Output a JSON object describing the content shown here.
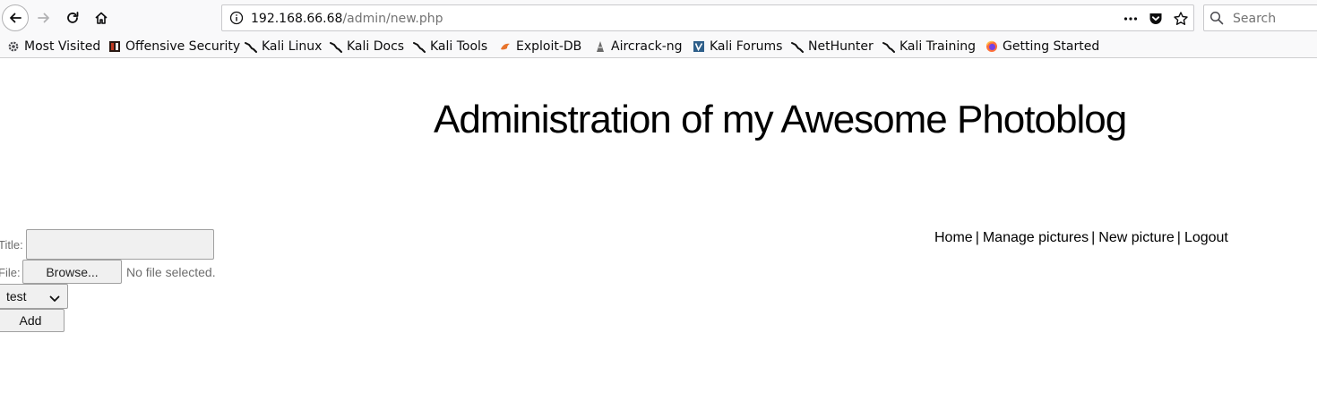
{
  "browser": {
    "url_host": "192.168.66.68",
    "url_path": "/admin/new.php",
    "search_placeholder": "Search",
    "bookmarks": [
      {
        "label": "Most Visited",
        "icon": "gear-icon"
      },
      {
        "label": "Offensive Security",
        "icon": "offsec-icon"
      },
      {
        "label": "Kali Linux",
        "icon": "kali-dragon-icon"
      },
      {
        "label": "Kali Docs",
        "icon": "kali-dragon-icon"
      },
      {
        "label": "Kali Tools",
        "icon": "kali-dragon-icon"
      },
      {
        "label": "Exploit-DB",
        "icon": "exploit-db-icon"
      },
      {
        "label": "Aircrack-ng",
        "icon": "aircrack-icon"
      },
      {
        "label": "Kali Forums",
        "icon": "kali-forums-icon"
      },
      {
        "label": "NetHunter",
        "icon": "kali-dragon-icon"
      },
      {
        "label": "Kali Training",
        "icon": "kali-dragon-icon"
      },
      {
        "label": "Getting Started",
        "icon": "firefox-icon"
      }
    ]
  },
  "page": {
    "title": "Administration of my Awesome Photoblog",
    "menu": {
      "home": "Home",
      "manage": "Manage pictures",
      "new": "New picture",
      "logout": "Logout",
      "separator": "|"
    },
    "form": {
      "title_label": "Title:",
      "title_value": "",
      "file_label": "File:",
      "browse_label": "Browse...",
      "no_file_text": "No file selected.",
      "category_selected": "test",
      "add_label": "Add"
    }
  },
  "colors": {
    "chrome_bg": "#f9f9fa",
    "text": "#0c0c0d",
    "muted": "#737373"
  }
}
